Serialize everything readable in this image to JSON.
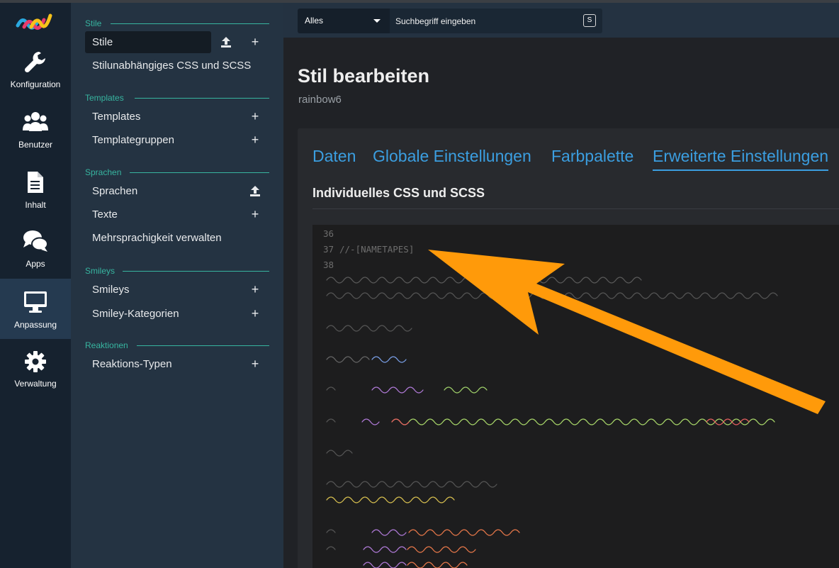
{
  "rail": {
    "items": [
      {
        "label": "Konfiguration",
        "icon": "wrench-icon"
      },
      {
        "label": "Benutzer",
        "icon": "users-icon"
      },
      {
        "label": "Inhalt",
        "icon": "file-icon"
      },
      {
        "label": "Apps",
        "icon": "comments-icon"
      },
      {
        "label": "Anpassung",
        "icon": "monitor-icon",
        "active": true
      },
      {
        "label": "Verwaltung",
        "icon": "gear-icon"
      }
    ]
  },
  "sidebar": {
    "groups": [
      {
        "title": "Stile",
        "items": [
          {
            "label": "Stile",
            "active": true,
            "actions": [
              "upload-icon",
              "plus-icon"
            ]
          },
          {
            "label": "Stilunabhängiges CSS und SCSS"
          }
        ]
      },
      {
        "title": "Templates",
        "items": [
          {
            "label": "Templates",
            "actions": [
              "plus-icon"
            ]
          },
          {
            "label": "Templategruppen",
            "actions": [
              "plus-icon"
            ]
          }
        ]
      },
      {
        "title": "Sprachen",
        "items": [
          {
            "label": "Sprachen",
            "actions": [
              "upload-icon"
            ]
          },
          {
            "label": "Texte",
            "actions": [
              "plus-icon"
            ]
          },
          {
            "label": "Mehrsprachigkeit verwalten"
          }
        ]
      },
      {
        "title": "Smileys",
        "items": [
          {
            "label": "Smileys",
            "actions": [
              "plus-icon"
            ]
          },
          {
            "label": "Smiley-Kategorien",
            "actions": [
              "plus-icon"
            ]
          }
        ]
      },
      {
        "title": "Reaktionen",
        "items": [
          {
            "label": "Reaktions-Typen",
            "actions": [
              "plus-icon"
            ]
          }
        ]
      }
    ]
  },
  "search": {
    "category": "Alles",
    "placeholder": "Suchbegriff eingeben",
    "shortcut": "S"
  },
  "page": {
    "title": "Stil bearbeiten",
    "subtitle": "rainbow6"
  },
  "tabs": [
    {
      "label": "Daten"
    },
    {
      "label": "Globale Einstellungen"
    },
    {
      "label": "Farbpalette"
    },
    {
      "label": "Erweiterte Einstellungen",
      "active": true
    }
  ],
  "section": {
    "title": "Individuelles CSS und SCSS"
  },
  "editor": {
    "lines": [
      {
        "number": "36",
        "text": ""
      },
      {
        "number": "37",
        "text": "//-[NAMETAPES]"
      },
      {
        "number": "38",
        "text": ""
      }
    ]
  },
  "colors": {
    "accent": "#3b9ee0",
    "group_title": "#37b5a0",
    "arrow": "#ff9a0a",
    "rail_bg": "#16222f",
    "sidebar_bg": "#243342"
  }
}
